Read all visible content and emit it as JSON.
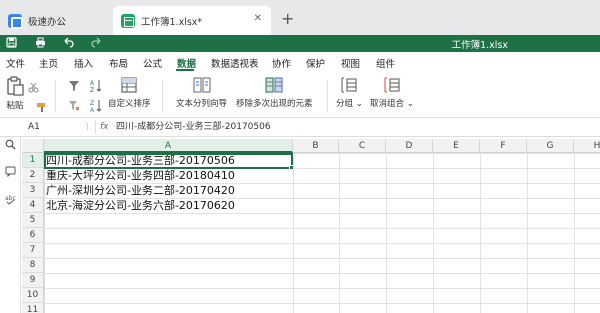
{
  "tabs": {
    "home_label": "极速办公",
    "workbook_label": "工作簿1.xlsx*"
  },
  "quickbar": {
    "document_title": "工作簿1.xlsx"
  },
  "menu": {
    "items": [
      "文件",
      "主页",
      "插入",
      "布局",
      "公式",
      "数据",
      "数据透视表",
      "协作",
      "保护",
      "视图",
      "组件"
    ],
    "active": "数据"
  },
  "ribbon": {
    "paste_label": "粘贴",
    "custom_sort_label": "自定义排序",
    "text_to_columns_label": "文本分列向导",
    "remove_duplicates_label": "移除多次出现的元素",
    "group_label": "分组",
    "ungroup_label": "取消组合"
  },
  "formula_bar": {
    "name_box": "A1",
    "fx_label": "fx",
    "formula": "四川-成都分公司-业务三部-20170506"
  },
  "sheet": {
    "columns": [
      "A",
      "B",
      "C",
      "D",
      "E",
      "F",
      "G",
      "H"
    ],
    "rows": [
      "1",
      "2",
      "3",
      "4",
      "5",
      "6",
      "7",
      "8",
      "9",
      "10",
      "11"
    ],
    "cells_col_a": [
      "四川-成都分公司-业务三部-20170506",
      "重庆-大坪分公司-业务四部-20180410",
      "广州-深圳分公司-业务二部-20170420",
      "北京-海淀分公司-业务六部-20170620"
    ],
    "active_cell": "A1"
  },
  "colors": {
    "accent": "#1e7145",
    "tabbar": "#e7e8ea"
  }
}
